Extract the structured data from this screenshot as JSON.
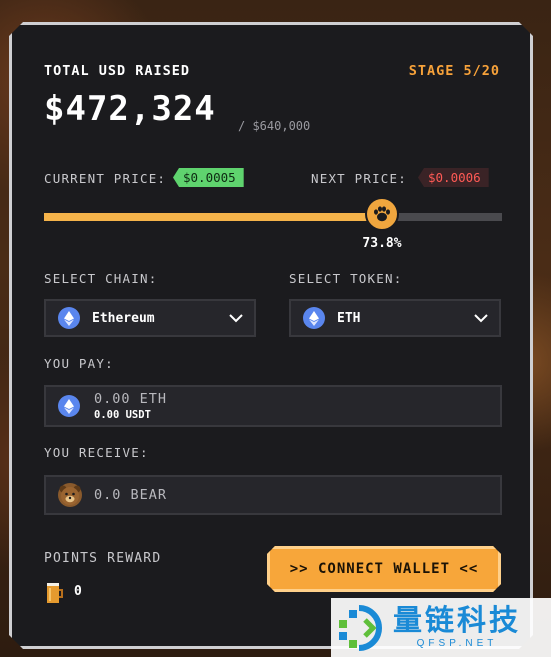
{
  "presale": {
    "total_label": "TOTAL USD RAISED",
    "stage": "STAGE 5/20",
    "raised": "$472,324",
    "target": "/ $640,000",
    "current_price_label": "CURRENT PRICE:",
    "current_price": "$0.0005",
    "next_price_label": "NEXT PRICE:",
    "next_price": "$0.0006",
    "progress_percent": 73.8,
    "progress_text": "73.8%"
  },
  "chain": {
    "label": "SELECT CHAIN:",
    "selected": "Ethereum",
    "icon": "ethereum-icon"
  },
  "token": {
    "label": "SELECT TOKEN:",
    "selected": "ETH",
    "icon": "eth-icon"
  },
  "pay": {
    "label": "YOU PAY:",
    "amount": "0.00 ETH",
    "usd": "0.00 USDT"
  },
  "receive": {
    "label": "YOU RECEIVE:",
    "amount": "0.0 BEAR"
  },
  "points": {
    "label": "POINTS REWARD",
    "value": "0"
  },
  "connect_button": {
    "label": ">> CONNECT WALLET <<"
  },
  "colors": {
    "accent": "#f7a63a",
    "current_price": "#5fd36e",
    "next_price": "#ff5a55",
    "panel": "#1b1b1e"
  },
  "watermark": {
    "text_cn": "量链科技",
    "text_en": "QFSP.NET"
  }
}
